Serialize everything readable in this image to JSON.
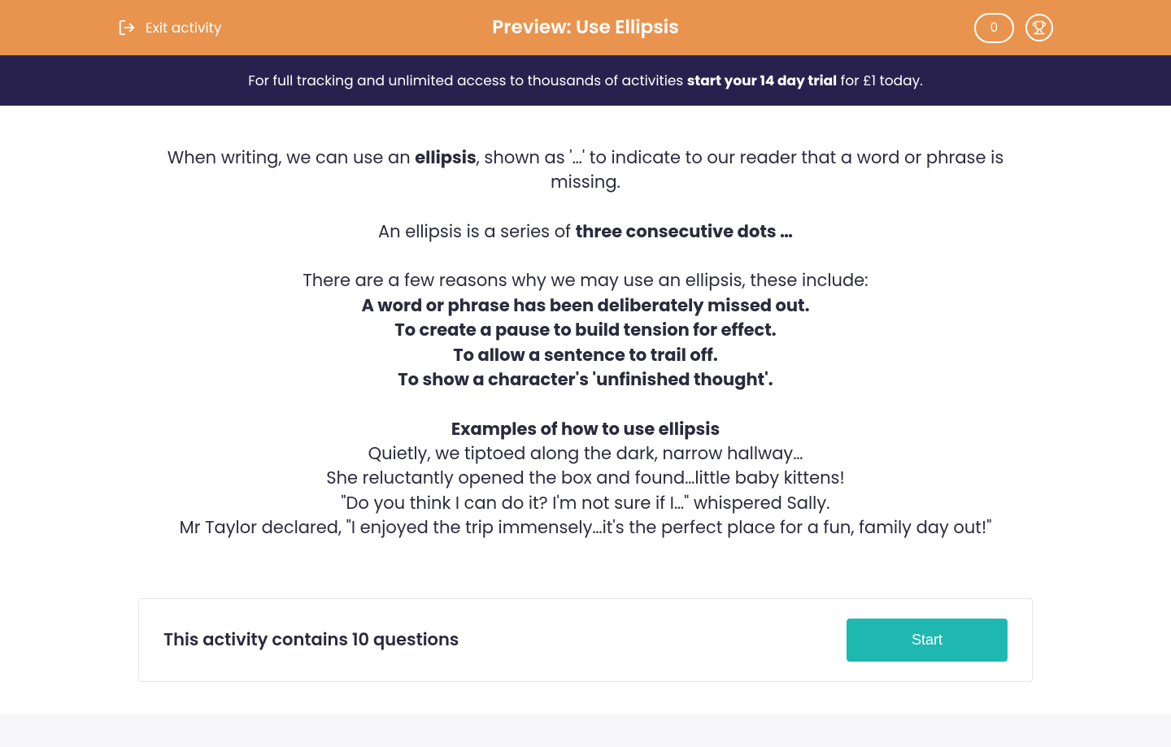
{
  "header": {
    "exit_label": "Exit activity",
    "title": "Preview: Use Ellipsis",
    "score": "0"
  },
  "banner": {
    "pre": "For full tracking and unlimited access to thousands of activities ",
    "bold": "start your 14 day trial",
    "post": " for £1 today."
  },
  "content": {
    "p1_pre": "When writing, we can use an ",
    "p1_bold": "ellipsis",
    "p1_post": ", shown as '…' to indicate to our reader that a word or phrase is missing.",
    "p2_pre": "An ellipsis is a series of ",
    "p2_bold": "three consecutive dots …",
    "p3_intro": "There are a few reasons why we may use an ellipsis, these include:",
    "reason1": "A word or phrase has been deliberately missed out.",
    "reason2": "To create a pause to build tension for effect.",
    "reason3": "To allow a sentence to trail off.",
    "reason4": "To show a character's 'unfinished thought'.",
    "examples_heading": "Examples of how to use ellipsis",
    "ex1": "Quietly, we tiptoed along the dark, narrow hallway…",
    "ex2": "She reluctantly opened the box and found…little baby kittens!",
    "ex3": "\"Do you think I can do it? I'm not sure if I…\" whispered Sally.",
    "ex4": "Mr Taylor declared, \"I enjoyed the trip immensely…it's the perfect place for a fun, family day out!\""
  },
  "action": {
    "question_count_text": "This activity contains 10 questions",
    "start_label": "Start"
  }
}
